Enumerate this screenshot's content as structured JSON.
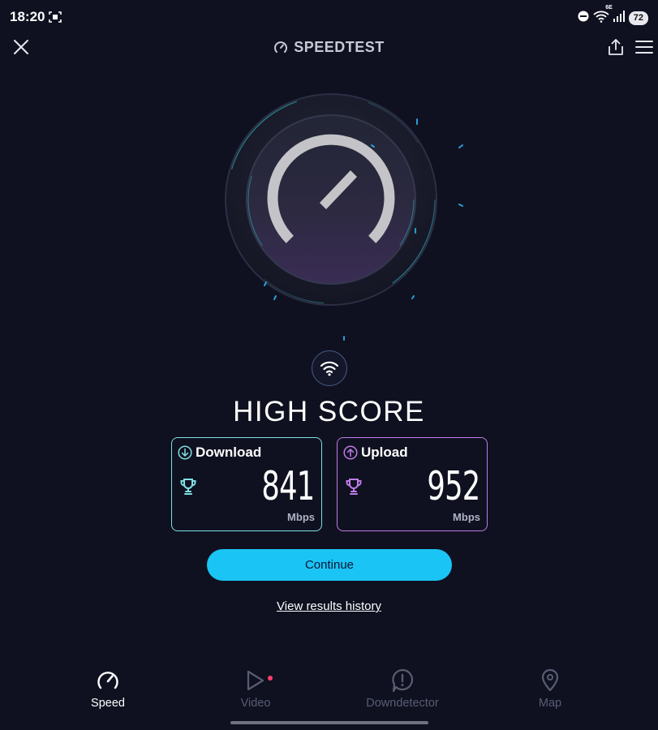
{
  "status_bar": {
    "time": "18:20",
    "wifi_badge": "6E",
    "battery": "72",
    "icons": [
      "screen-record-icon",
      "do-not-disturb-icon",
      "wifi-icon",
      "signal-icon",
      "battery-icon"
    ]
  },
  "header": {
    "title": "SPEEDTEST",
    "close_icon": "close-icon",
    "share_icon": "share-icon",
    "menu_icon": "menu-icon"
  },
  "gauge": {
    "icon": "speedometer-gauge",
    "colors": {
      "arc": "#c4c4c8",
      "accent": "#2a9fd6"
    }
  },
  "connection_icon": "wifi-icon",
  "headline": "HIGH SCORE",
  "results": {
    "download": {
      "label": "Download",
      "value": "841",
      "unit": "Mbps",
      "color": "#7fe0e4",
      "icon": "arrow-down-circle-icon"
    },
    "upload": {
      "label": "Upload",
      "value": "952",
      "unit": "Mbps",
      "color": "#c07be8",
      "icon": "arrow-up-circle-icon"
    }
  },
  "continue_label": "Continue",
  "history_link": "View results history",
  "bottom_nav": {
    "items": [
      {
        "label": "Speed",
        "icon": "speedometer-icon",
        "active": true
      },
      {
        "label": "Video",
        "icon": "play-icon",
        "active": false
      },
      {
        "label": "Downdetector",
        "icon": "alert-icon",
        "active": false
      },
      {
        "label": "Map",
        "icon": "map-pin-icon",
        "active": false
      }
    ]
  },
  "colors": {
    "background": "#0f1120",
    "primary_button": "#1ac4f5",
    "notification_dot": "#ff3d6a"
  }
}
